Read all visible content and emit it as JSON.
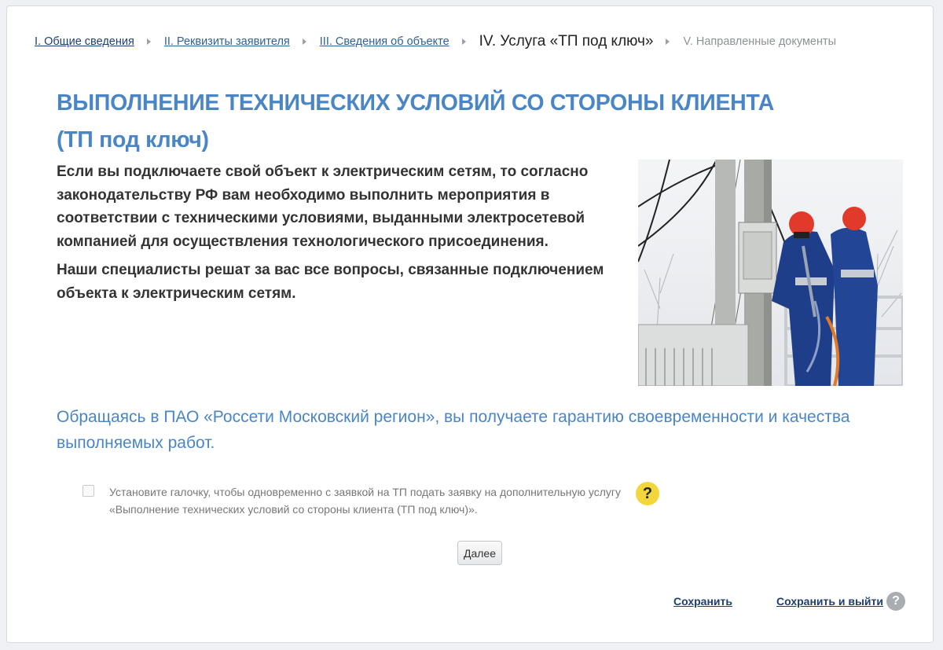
{
  "breadcrumb": {
    "step1": "I. Общие сведения",
    "step2": "II. Реквизиты заявителя",
    "step3": "III. Сведения об объекте",
    "step4": "IV. Услуга «ТП под ключ»",
    "step5": "V. Направленные документы"
  },
  "main": {
    "title_line1": "ВЫПОЛНЕНИЕ ТЕХНИЧЕСКИХ УСЛОВИЙ СО СТОРОНЫ КЛИЕНТА",
    "title_line2": "(ТП под ключ)",
    "intro_p1": "Если вы подключаете свой объект к электрическим сетям, то согласно законодательству РФ вам необходимо выполнить мероприятия в соответствии с техническими условиями, выданными электросетевой компанией для осуществления технологического присоединения.",
    "intro_p2": "Наши специалисты решат за вас все вопросы, связанные подключением объекта к электрическим сетям.",
    "guarantee": "Обращаясь в ПАО «Россети Московский регион», вы получаете гарантию своевременности и качества выполняемых работ."
  },
  "option": {
    "checkbox_label": "Установите галочку, чтобы одновременно с заявкой на ТП подать заявку на дополнительную услугу «Выполнение технических условий со стороны клиента (ТП под ключ)».",
    "checked": false,
    "help_symbol": "?"
  },
  "actions": {
    "next_label": "Далее",
    "save_label": "Сохранить",
    "save_exit_label": "Сохранить и выйти",
    "help_symbol": "?"
  },
  "colors": {
    "accent": "#4a86c5",
    "link": "#1f3f6e",
    "help_yellow": "#f3d63a",
    "help_grey": "#a9adb2"
  }
}
